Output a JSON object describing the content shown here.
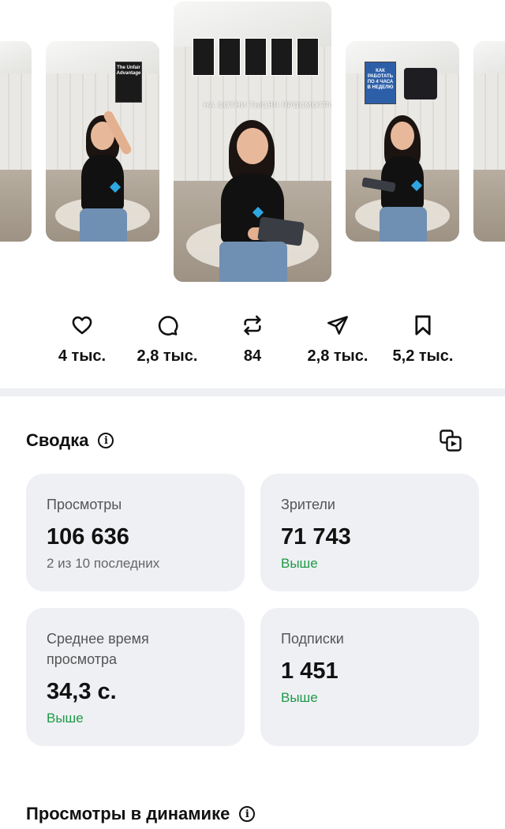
{
  "reels": {
    "card2_book_title": "The Unfair Advantage",
    "card3_overlay": "НА СОТНИ ТЫСЯЧ ПРОСМОТРОВ",
    "card4_book_title": "КАК РАБОТАТЬ ПО 4 ЧАСА В НЕДЕЛЮ"
  },
  "actions": [
    {
      "icon": "heart-icon",
      "count": "4 тыс."
    },
    {
      "icon": "comment-icon",
      "count": "2,8 тыс."
    },
    {
      "icon": "repost-icon",
      "count": "84"
    },
    {
      "icon": "send-icon",
      "count": "2,8 тыс."
    },
    {
      "icon": "bookmark-icon",
      "count": "5,2 тыс."
    }
  ],
  "summary": {
    "title": "Сводка",
    "tiles": {
      "views": {
        "label": "Просмотры",
        "value": "106 636",
        "note": "2 из 10 последних"
      },
      "viewers": {
        "label": "Зрители",
        "value": "71 743",
        "trend": "Выше"
      },
      "avg_time": {
        "label": "Среднее время просмотра",
        "value": "34,3 с.",
        "trend": "Выше"
      },
      "follows": {
        "label": "Подписки",
        "value": "1 451",
        "trend": "Выше"
      }
    }
  },
  "dynamics": {
    "title": "Просмотры в динамике"
  },
  "colors": {
    "accent_green": "#1e9a46",
    "tile_bg": "#eef0f4"
  }
}
